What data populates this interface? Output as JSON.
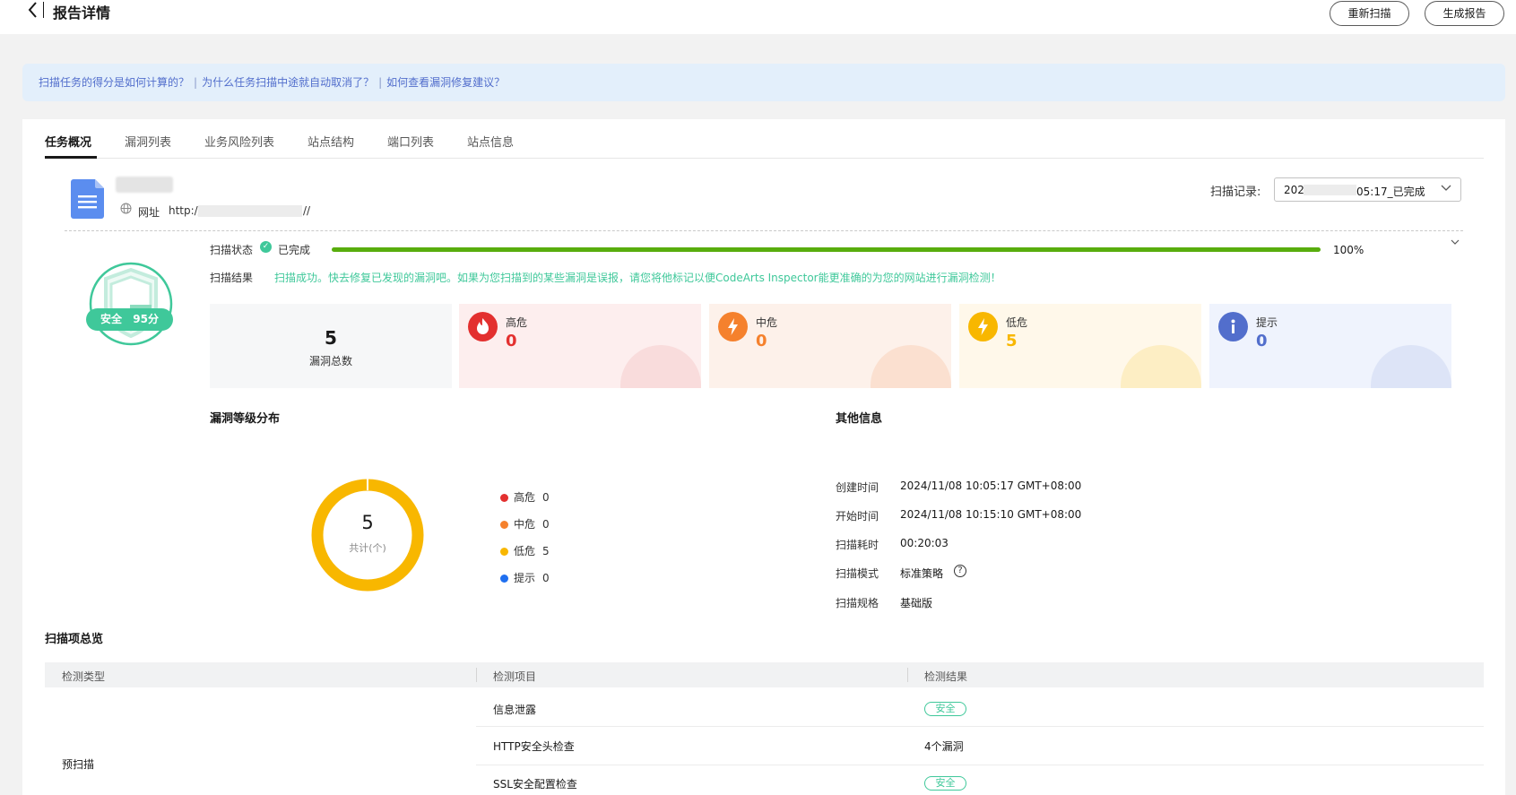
{
  "header": {
    "back_icon": "chevron-left-icon",
    "title": "报告详情",
    "rescan_label": "重新扫描",
    "report_label": "生成报告"
  },
  "notice": {
    "links": [
      "扫描任务的得分是如何计算的？",
      "为什么任务扫描中途就自动取消了？",
      "如何查看漏洞修复建议？"
    ],
    "separator": "|"
  },
  "tabs": [
    "任务概况",
    "漏洞列表",
    "业务风险列表",
    "站点结构",
    "端口列表",
    "站点信息"
  ],
  "site": {
    "url_label": "网址",
    "url_prefix": "http://",
    "url_suffix": "//"
  },
  "scan_record": {
    "label": "扫描记录:",
    "value_prefix": "202",
    "value_suffix": "05:17_已完成"
  },
  "score": {
    "level": "安全",
    "points": "95分"
  },
  "status": {
    "label": "扫描状态",
    "value": "已完成",
    "progress": 1.0,
    "progress_text": "100%",
    "result_label": "扫描结果",
    "result_text": "扫描成功。快去修复已发现的漏洞吧。如果为您扫描到的某些漏洞是误报，请您将他标记以便CodeArts Inspector能更准确的为您的网站进行漏洞检测！"
  },
  "stats": {
    "total": {
      "value": "5",
      "label": "漏洞总数"
    },
    "high": {
      "label": "高危",
      "value": "0",
      "color": "#e3302f",
      "icon": "flame-icon"
    },
    "mid": {
      "label": "中危",
      "value": "0",
      "color": "#f5812d",
      "icon": "bolt-icon"
    },
    "low": {
      "label": "低危",
      "value": "5",
      "color": "#f8b700",
      "icon": "bolt-icon"
    },
    "tip": {
      "label": "提示",
      "value": "0",
      "color": "#526ecc",
      "icon": "info-icon"
    }
  },
  "distribution": {
    "title": "漏洞等级分布",
    "total": "5",
    "total_label": "共计(个)",
    "legend": [
      {
        "label": "高危",
        "value": "0",
        "color": "#e3302f"
      },
      {
        "label": "中危",
        "value": "0",
        "color": "#f5812d"
      },
      {
        "label": "低危",
        "value": "5",
        "color": "#f8b700"
      },
      {
        "label": "提示",
        "value": "0",
        "color": "#1f6ff0"
      }
    ]
  },
  "other_info": {
    "title": "其他信息",
    "rows": [
      {
        "label": "创建时间",
        "value": "2024/11/08 10:05:17 GMT+08:00"
      },
      {
        "label": "开始时间",
        "value": "2024/11/08 10:15:10 GMT+08:00"
      },
      {
        "label": "扫描耗时",
        "value": "00:20:03"
      },
      {
        "label": "扫描模式",
        "value": "标准策略"
      },
      {
        "label": "扫描规格",
        "value": "基础版"
      }
    ]
  },
  "overview": {
    "title": "扫描项总览",
    "columns": [
      "检测类型",
      "检测项目",
      "检测结果"
    ],
    "group": "预扫描",
    "rows": [
      {
        "item": "信息泄露",
        "result": "安全",
        "tag": true
      },
      {
        "item": "HTTP安全头检查",
        "result": "4个漏洞",
        "tag": false
      },
      {
        "item": "SSL安全配置检查",
        "result": "安全",
        "tag": true
      }
    ]
  }
}
